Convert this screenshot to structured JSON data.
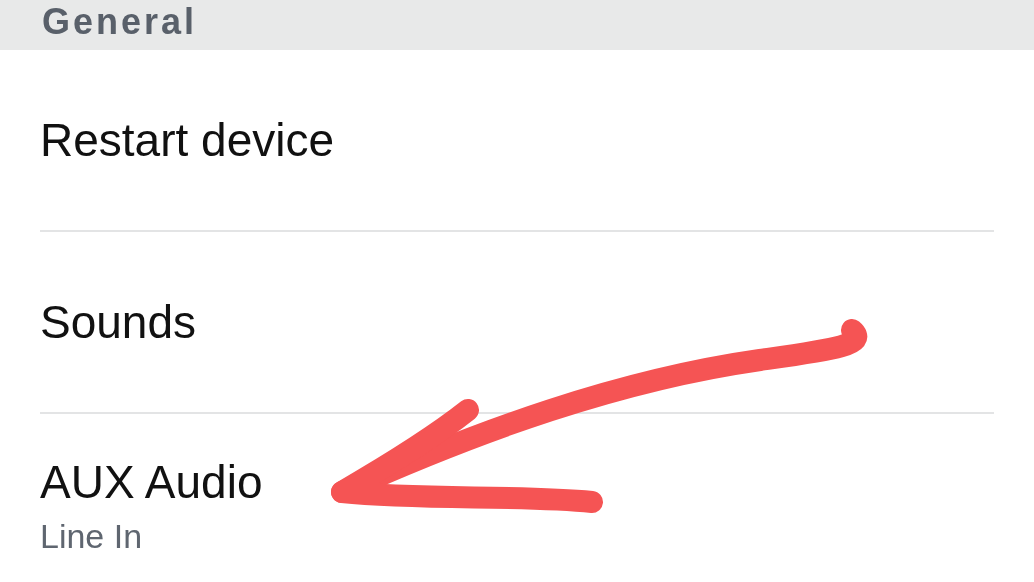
{
  "section": {
    "title": "General"
  },
  "items": [
    {
      "title": "Restart device"
    },
    {
      "title": "Sounds"
    },
    {
      "title": "AUX Audio",
      "subtitle": "Line In"
    }
  ]
}
